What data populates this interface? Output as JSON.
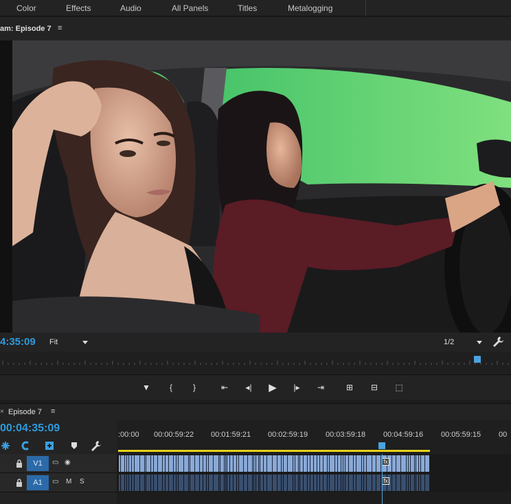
{
  "workspaces": [
    "Color",
    "Effects",
    "Audio",
    "All Panels",
    "Titles",
    "Metalogging"
  ],
  "program_monitor": {
    "title": "am: Episode 7",
    "menu_icon": "hamburger-icon",
    "timecode": "4:35:09",
    "zoom": "Fit",
    "resolution": "1/2",
    "settings_icon": "wrench-icon",
    "transport": [
      "add-marker-icon",
      "mark-in-icon",
      "mark-out-icon",
      "go-to-in-icon",
      "step-back-icon",
      "play-icon",
      "step-forward-icon",
      "go-to-out-icon",
      "insert-icon",
      "overwrite-icon",
      "camera-icon"
    ],
    "transport_glyphs": [
      "▼",
      "{",
      "}",
      "⇤",
      "◂|",
      "▶",
      "|▸",
      "⇥",
      "⊞",
      "⊟",
      "⬚"
    ]
  },
  "timeline": {
    "close_glyph": "×",
    "title": "Episode 7",
    "menu_icon": "hamburger-icon",
    "timecode": "00:04:35:09",
    "ruler_labels": [
      ":00:00",
      "00:00:59:22",
      "00:01:59:21",
      "00:02:59:19",
      "00:03:59:18",
      "00:04:59:16",
      "00:05:59:15",
      "00"
    ],
    "tracks": [
      {
        "name": "V1",
        "icons": [
          "film-icon",
          "eye-icon"
        ],
        "glyphs": [
          "▭",
          "◉"
        ],
        "clip_color": "#8aa9d6"
      },
      {
        "name": "A1",
        "icons": [
          "film-icon",
          "M",
          "S"
        ],
        "glyphs": [
          "▭",
          "M",
          "S"
        ],
        "clip_color": "#3a4f6e"
      }
    ],
    "fx_glyph": "fx"
  },
  "colors": {
    "accent": "#2d9bdc",
    "workarea": "#e6d31a",
    "video_clip": "#8aa9d6",
    "audio_clip": "#3a4f6e"
  }
}
